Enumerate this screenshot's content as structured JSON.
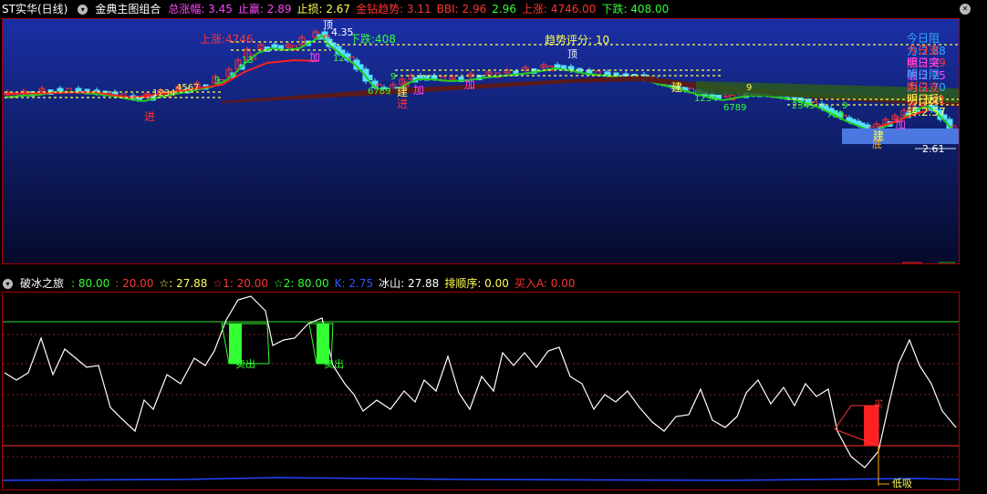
{
  "header": {
    "title": "ST实华(日线)",
    "indicator_name": "金典主图组合",
    "items": [
      {
        "label": "总涨幅:",
        "value": "3.45",
        "color": "#ff44ff"
      },
      {
        "label": "止赢:",
        "value": "2.89",
        "color": "#ff44ff"
      },
      {
        "label": "止损:",
        "value": "2.67",
        "color": "#ffff55"
      },
      {
        "label": "金钻趋势:",
        "value": "3.11",
        "color": "#ff3333"
      },
      {
        "label": "BBI:",
        "value": "2.96",
        "color": "#ff3333"
      },
      {
        "label": "",
        "value": "2.96",
        "color": "#33ff33"
      },
      {
        "label": "上涨:",
        "value": "4746.00",
        "color": "#ff3333"
      },
      {
        "label": "下跌:",
        "value": "408.00",
        "color": "#33ff33"
      }
    ]
  },
  "main_chart": {
    "annotations": {
      "up_label": "上涨:4746",
      "down_label": "下跌:408",
      "trend_score": "趋势评分: 10",
      "peak_label_1": "顶",
      "peak_value": "4.35",
      "peak_label_2": "顶",
      "bottom_label": "底",
      "bottom_value": "2.61",
      "in_label_1": "进",
      "in_label_2": "进",
      "add_1": "加",
      "add_2": "加",
      "add_3": "加",
      "add_4": "加",
      "build_1": "建",
      "build_2": "建",
      "build_3": "建",
      "cnt_1": "1234",
      "cnt_2": "4567",
      "cnt_3": "13",
      "cnt_4": "12",
      "cnt_5": "6789",
      "cnt_6": "1234",
      "cnt_7": "6789",
      "cnt_8": "2345",
      "cnt_9": "789",
      "nine_1": "9",
      "nine_2": "9",
      "nine_3": "9",
      "nine_4": "9",
      "five_label": "5",
      "cai_label": "财",
      "fan_label": "反转",
      "bottom_event_1": "财预",
      "bottom_event_2": "跌"
    },
    "levels": [
      {
        "label": "今日阻力:",
        "value": "2.88",
        "color": "#33aaff"
      },
      {
        "label": "今日支撑:",
        "value": "2.89",
        "color": "#ff3333"
      },
      {
        "label": "明日突破:",
        "value": "2.75",
        "color": "#ff44ff"
      },
      {
        "label": "明日阻力:",
        "value": "2.70",
        "color": "#33aaff"
      },
      {
        "label": "明日支撑:",
        "value": "2.61",
        "color": "#ff3333"
      },
      {
        "label": "明日反转:",
        "value": "2.57",
        "color": "#ffff55"
      }
    ]
  },
  "indicator": {
    "name": "破冰之旅",
    "items": [
      {
        "label": "",
        "value": "80.00",
        "color": "#33ff33"
      },
      {
        "label": "",
        "value": "20.00",
        "color": "#ff3333"
      },
      {
        "label": "☆:",
        "value": "27.88",
        "color": "#ffff55"
      },
      {
        "label": "☆1:",
        "value": "20.00",
        "color": "#ff3333"
      },
      {
        "label": "☆2:",
        "value": "80.00",
        "color": "#33ff33"
      },
      {
        "label": "K:",
        "value": "2.75",
        "color": "#3355ff"
      },
      {
        "label": "冰山:",
        "value": "27.88",
        "color": "#ffffff"
      },
      {
        "label": "排顺序:",
        "value": "0.00",
        "color": "#ffff55"
      },
      {
        "label": "买入A:",
        "value": "0.00",
        "color": "#ff3333"
      }
    ],
    "sell_label_1": "卖出",
    "sell_label_2": "卖出",
    "low_buy_label": "低吸",
    "buy_label": "买"
  },
  "colors": {
    "up": "#ff3333",
    "down": "#55e0ff",
    "ma_red": "#ff2020",
    "ma_green": "#22cc22",
    "level_dot": "#ffff55"
  }
}
